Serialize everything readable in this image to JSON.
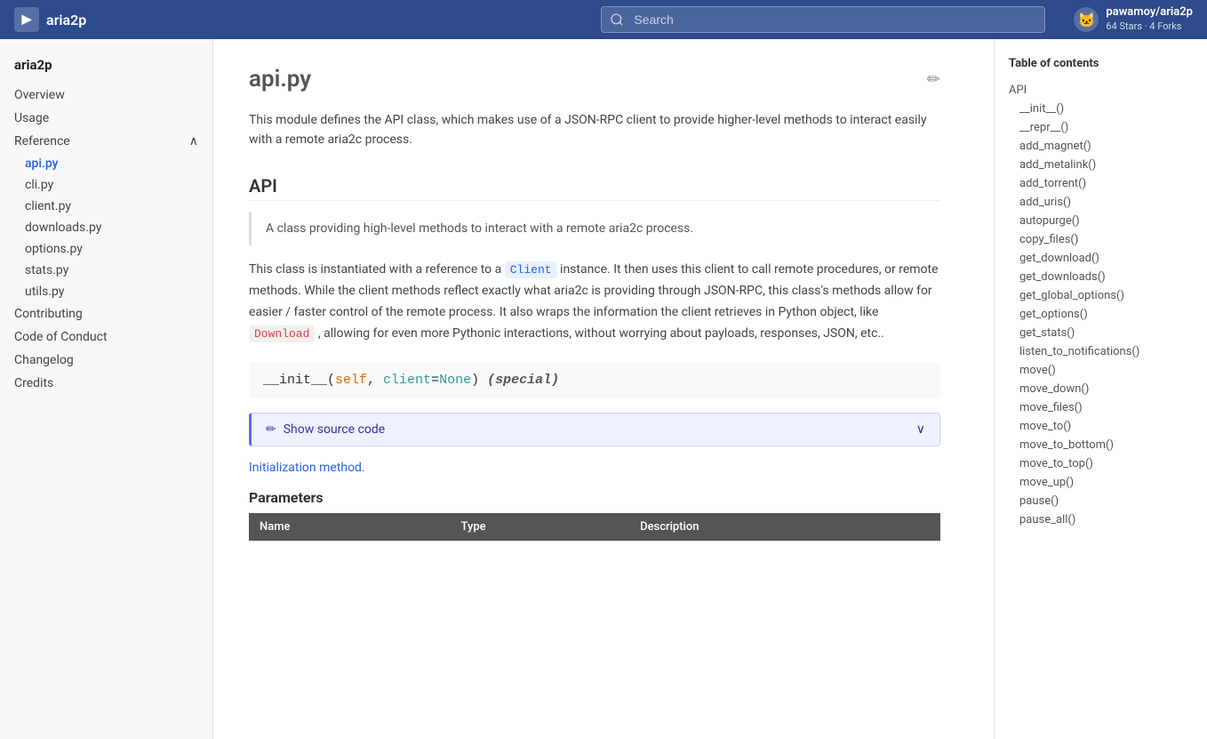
{
  "header": {
    "logo_text": "▶",
    "title": "aria2p",
    "search_placeholder": "Search",
    "github_icon": "🐱",
    "github_repo": "pawamoy/aria2p",
    "github_stats": "64 Stars · 4 Forks"
  },
  "sidebar": {
    "brand": "aria2p",
    "items": [
      {
        "label": "Overview",
        "id": "overview",
        "active": false,
        "sub": false
      },
      {
        "label": "Usage",
        "id": "usage",
        "active": false,
        "sub": false
      },
      {
        "label": "Reference",
        "id": "reference",
        "active": false,
        "sub": false,
        "expandable": true
      },
      {
        "label": "api.py",
        "id": "api-py",
        "active": true,
        "sub": true
      },
      {
        "label": "cli.py",
        "id": "cli-py",
        "active": false,
        "sub": true
      },
      {
        "label": "client.py",
        "id": "client-py",
        "active": false,
        "sub": true
      },
      {
        "label": "downloads.py",
        "id": "downloads-py",
        "active": false,
        "sub": true
      },
      {
        "label": "options.py",
        "id": "options-py",
        "active": false,
        "sub": true
      },
      {
        "label": "stats.py",
        "id": "stats-py",
        "active": false,
        "sub": true
      },
      {
        "label": "utils.py",
        "id": "utils-py",
        "active": false,
        "sub": true
      },
      {
        "label": "Contributing",
        "id": "contributing",
        "active": false,
        "sub": false
      },
      {
        "label": "Code of Conduct",
        "id": "code-of-conduct",
        "active": false,
        "sub": false
      },
      {
        "label": "Changelog",
        "id": "changelog",
        "active": false,
        "sub": false
      },
      {
        "label": "Credits",
        "id": "credits",
        "active": false,
        "sub": false
      }
    ]
  },
  "main": {
    "page_title": "api.py",
    "intro": "This module defines the API class, which makes use of a JSON-RPC client to provide higher-level methods to interact easily with a remote aria2c process.",
    "api_section": "API",
    "api_desc": "A class providing high-level methods to interact with a remote aria2c process.",
    "api_body1_before": "This class is instantiated with a reference to a",
    "api_client_code": "Client",
    "api_body1_after": "instance. It then uses this client to call remote procedures, or remote methods. While the client methods reflect exactly what aria2c is providing through JSON-RPC, this class's methods allow for easier / faster control of the remote process. It also wraps the information the client retrieves in Python object, like",
    "api_download_code": "Download",
    "api_body1_end": ", allowing for even more Pythonic interactions, without worrying about payloads, responses, JSON, etc..",
    "method_name": "__init__",
    "method_self": "self",
    "method_param": "client",
    "method_default": "None",
    "method_special": "(special)",
    "show_source_label": "Show source code",
    "init_text": "Initialization method.",
    "params_heading": "Parameters",
    "params_table": {
      "headers": [
        "Name",
        "Type",
        "Description"
      ],
      "rows": []
    }
  },
  "toc": {
    "title": "Table of contents",
    "items": [
      {
        "label": "API",
        "id": "api",
        "sub": false
      },
      {
        "label": "__init__()",
        "id": "init",
        "sub": true
      },
      {
        "label": "__repr__()",
        "id": "repr",
        "sub": true
      },
      {
        "label": "add_magnet()",
        "id": "add_magnet",
        "sub": true
      },
      {
        "label": "add_metalink()",
        "id": "add_metalink",
        "sub": true
      },
      {
        "label": "add_torrent()",
        "id": "add_torrent",
        "sub": true
      },
      {
        "label": "add_uris()",
        "id": "add_uris",
        "sub": true
      },
      {
        "label": "autopurge()",
        "id": "autopurge",
        "sub": true
      },
      {
        "label": "copy_files()",
        "id": "copy_files",
        "sub": true
      },
      {
        "label": "get_download()",
        "id": "get_download",
        "sub": true
      },
      {
        "label": "get_downloads()",
        "id": "get_downloads",
        "sub": true
      },
      {
        "label": "get_global_options()",
        "id": "get_global_options",
        "sub": true
      },
      {
        "label": "get_options()",
        "id": "get_options",
        "sub": true
      },
      {
        "label": "get_stats()",
        "id": "get_stats",
        "sub": true
      },
      {
        "label": "listen_to_notifications()",
        "id": "listen_to_notifications",
        "sub": true
      },
      {
        "label": "move()",
        "id": "move",
        "sub": true
      },
      {
        "label": "move_down()",
        "id": "move_down",
        "sub": true
      },
      {
        "label": "move_files()",
        "id": "move_files",
        "sub": true
      },
      {
        "label": "move_to()",
        "id": "move_to",
        "sub": true
      },
      {
        "label": "move_to_bottom()",
        "id": "move_to_bottom",
        "sub": true
      },
      {
        "label": "move_to_top()",
        "id": "move_to_top",
        "sub": true
      },
      {
        "label": "move_up()",
        "id": "move_up",
        "sub": true
      },
      {
        "label": "pause()",
        "id": "pause",
        "sub": true
      },
      {
        "label": "pause_all()",
        "id": "pause_all",
        "sub": true
      }
    ]
  }
}
